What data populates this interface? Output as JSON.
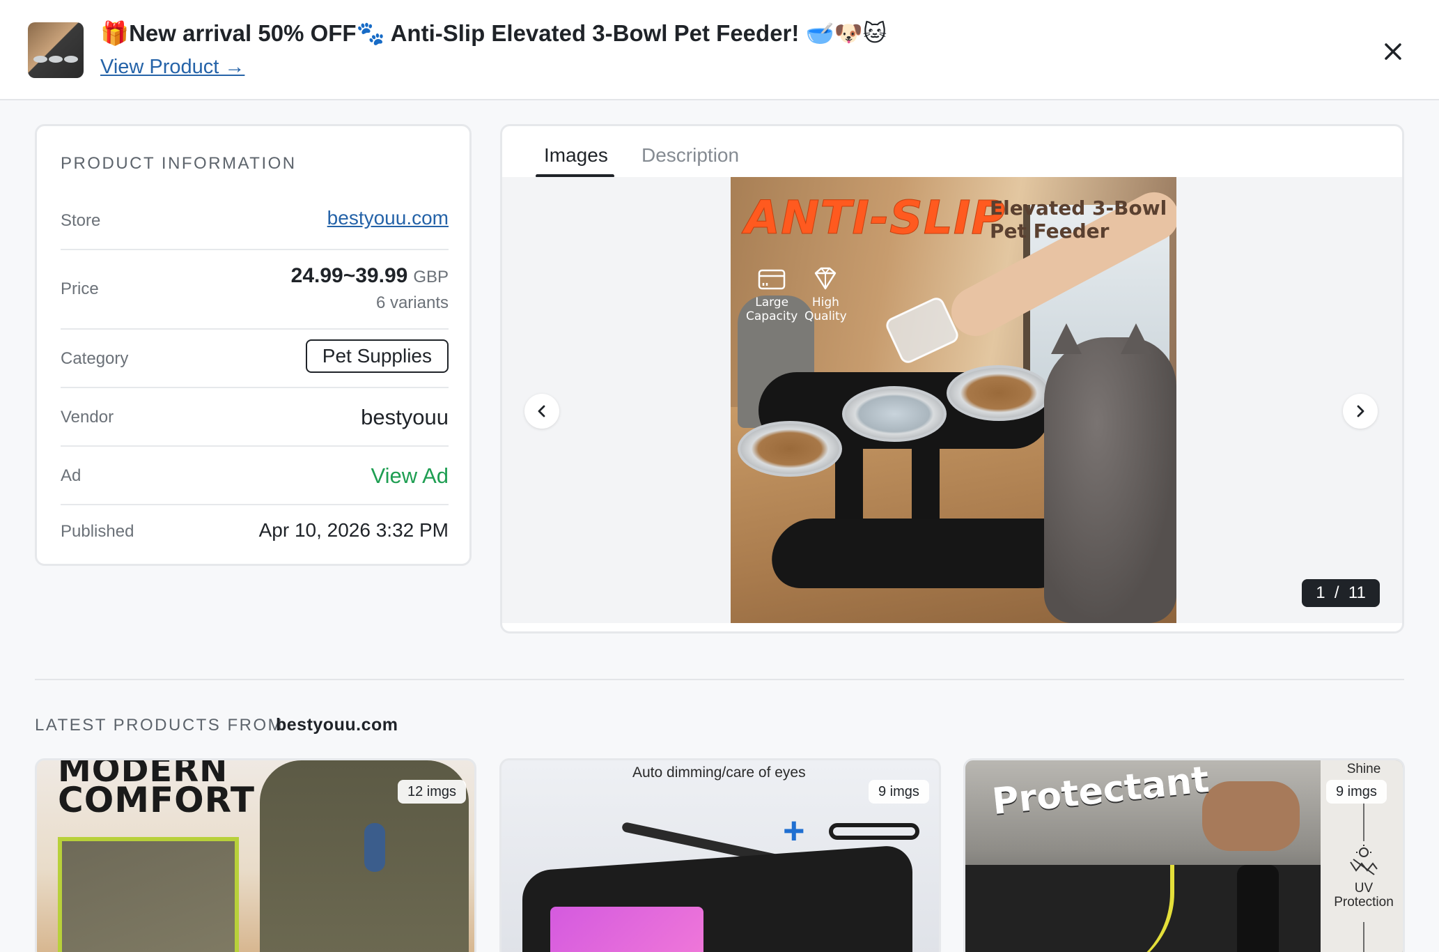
{
  "header": {
    "title": "🎁New arrival 50% OFF🐾 Anti-Slip Elevated 3-Bowl Pet Feeder! 🥣🐶🐱",
    "view_product": "View Product →",
    "close_icon": "close-icon"
  },
  "info": {
    "section_title": "PRODUCT INFORMATION",
    "store_label": "Store",
    "store_value": "bestyouu.com",
    "price_label": "Price",
    "price_value": "24.99~39.99",
    "price_currency": "GBP",
    "variants": "6 variants",
    "category_label": "Category",
    "category_value": "Pet Supplies",
    "vendor_label": "Vendor",
    "vendor_value": "bestyouu",
    "ad_label": "Ad",
    "ad_value": "View Ad",
    "published_label": "Published",
    "published_value": "Apr 10, 2026 3:32 PM"
  },
  "gallery": {
    "tabs": [
      "Images",
      "Description"
    ],
    "active_tab": "Images",
    "counter": "1  /  11",
    "image": {
      "headline": "ANTI-SLIP",
      "subtitle_line1": "Elevated 3-Bowl",
      "subtitle_line2": "Pet Feeder",
      "feature1_line1": "Large",
      "feature1_line2": "Capacity",
      "feature2_line1": "High",
      "feature2_line2": "Quality"
    }
  },
  "latest": {
    "label": "LATEST PRODUCTS FROM",
    "store": "bestyouu.com",
    "products": [
      {
        "badge": "12 imgs",
        "heading_top": "MODERN",
        "heading_bottom": "COMFORT"
      },
      {
        "badge": "9 imgs",
        "caption": "Auto dimming/care of eyes"
      },
      {
        "badge": "9 imgs",
        "heading": "Protectant",
        "side_top": "Shine",
        "side_bottom_1": "UV",
        "side_bottom_2": "Protection"
      }
    ]
  },
  "colors": {
    "accent_link": "#2563a8",
    "ad_green": "#1e9e52",
    "dark": "#1f2328",
    "headline_orange": "#ff5a1f"
  }
}
